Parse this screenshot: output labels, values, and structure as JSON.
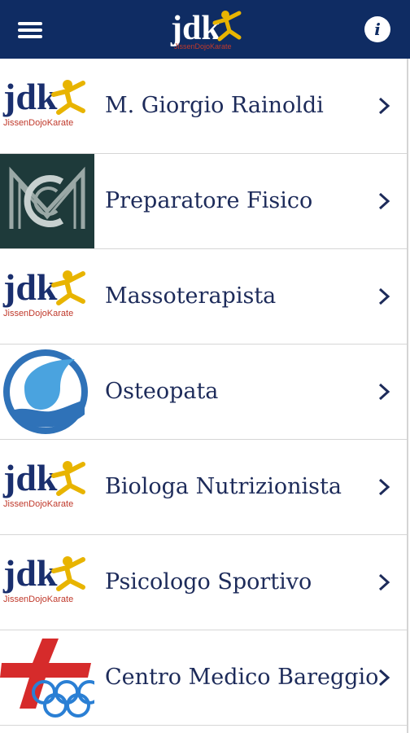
{
  "header": {
    "logo_text": "jdk",
    "logo_subtext": "JissenDojoKarate",
    "menu_icon": "hamburger-menu-icon",
    "info_icon": "info-icon",
    "info_glyph": "i"
  },
  "colors": {
    "topbar": "#0f2c63",
    "label_text": "#1d2b5a",
    "logo_blue": "#1a2f6e",
    "logo_gold": "#e8b400",
    "logo_red": "#c0392b"
  },
  "items": [
    {
      "label": "M. Giorgio Rainoldi",
      "thumb": "jdk-logo"
    },
    {
      "label": "Preparatore Fisico",
      "thumb": "cm-monogram-logo"
    },
    {
      "label": "Massoterapista",
      "thumb": "jdk-logo"
    },
    {
      "label": "Osteopata",
      "thumb": "water-drop-hand-logo"
    },
    {
      "label": "Biologa Nutrizionista",
      "thumb": "jdk-logo"
    },
    {
      "label": "Psicologo Sportivo",
      "thumb": "jdk-logo"
    },
    {
      "label": "Centro Medico Bareggio",
      "thumb": "medical-cross-olympic-logo"
    }
  ]
}
